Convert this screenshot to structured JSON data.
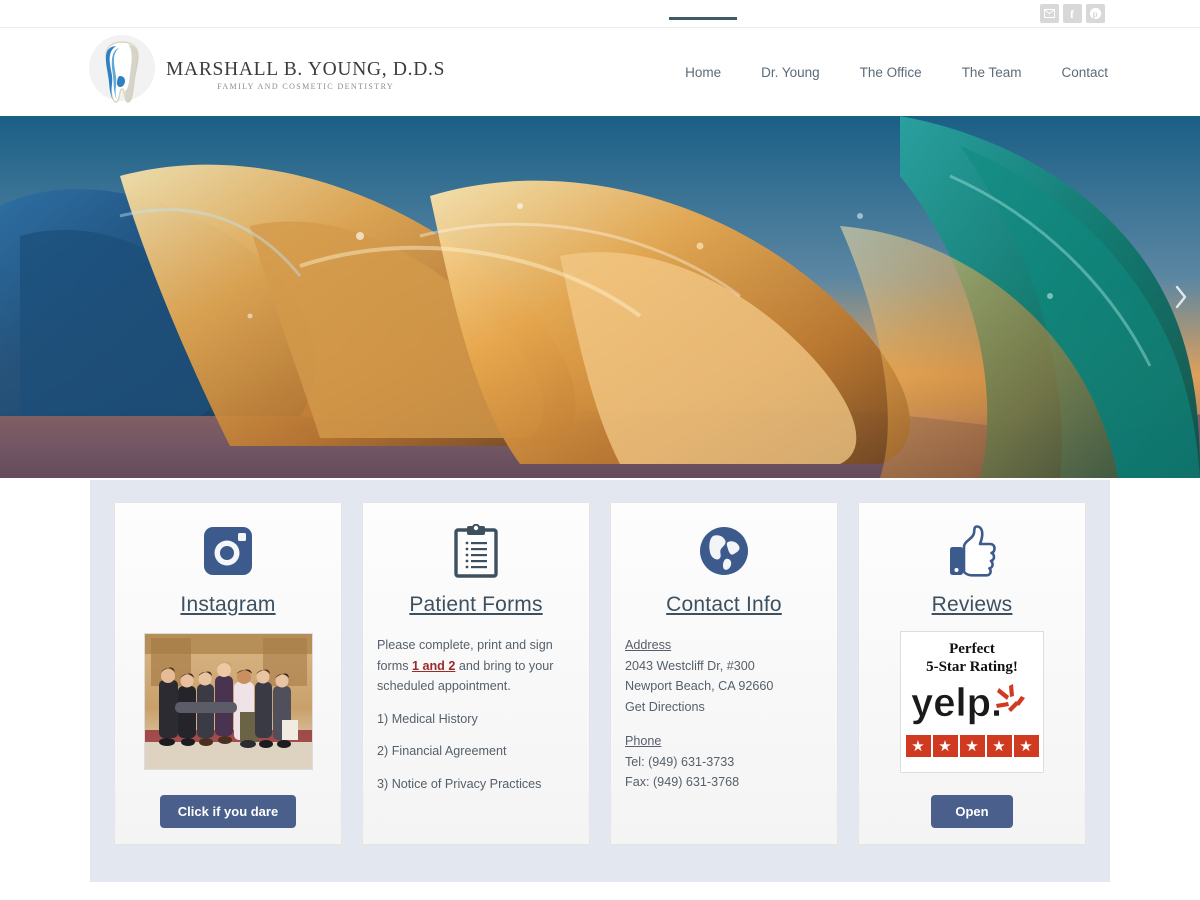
{
  "topbar": {
    "social": [
      {
        "name": "email-icon",
        "label": "Email"
      },
      {
        "name": "facebook-icon",
        "label": "Facebook"
      },
      {
        "name": "pinterest-icon",
        "label": "Pinterest"
      }
    ]
  },
  "header": {
    "logo_title": "MARSHALL B. YOUNG, D.D.S",
    "logo_subtitle": "FAMILY AND COSMETIC DENTISTRY",
    "nav": [
      {
        "label": "Home",
        "active": true
      },
      {
        "label": "Dr. Young",
        "active": false
      },
      {
        "label": "The Office",
        "active": false
      },
      {
        "label": "The Team",
        "active": false
      },
      {
        "label": "Contact",
        "active": false
      }
    ]
  },
  "hero": {
    "next_label": "›"
  },
  "cards": {
    "instagram": {
      "icon": "instagram-camera-icon",
      "title": "Instagram",
      "photo_alt": "Dental team group photo",
      "button": "Click if you dare"
    },
    "patient_forms": {
      "icon": "clipboard-icon",
      "title": "Patient Forms",
      "intro_part1": "Please complete, print and sign forms ",
      "intro_link": "1 and 2",
      "intro_part2": " and bring to your scheduled appointment.",
      "links": [
        "1) Medical History",
        "2) Financial Agreement",
        "3) Notice of Privacy Practices"
      ]
    },
    "contact_info": {
      "icon": "globe-icon",
      "title": "Contact Info",
      "address_label": "Address",
      "address_line1": "2043 Westcliff Dr, #300",
      "address_line2": "Newport Beach, CA 92660",
      "directions_link": "Get Directions",
      "phone_label": "Phone",
      "tel": "Tel: (949) 631-3733",
      "fax": "Fax: (949) 631-3768"
    },
    "reviews": {
      "icon": "thumbs-up-icon",
      "title": "Reviews",
      "badge_line1": "Perfect",
      "badge_line2": "5-Star Rating!",
      "badge_brand": "yelp",
      "badge_stars": 5,
      "button": "Open"
    }
  },
  "colors": {
    "accent_navy": "#4a5f8c",
    "icon_navy": "#3d5a8c",
    "panel_bg": "#e3e7ef",
    "link_red": "#9b2a2a",
    "yelp_red": "#cf3a20"
  }
}
